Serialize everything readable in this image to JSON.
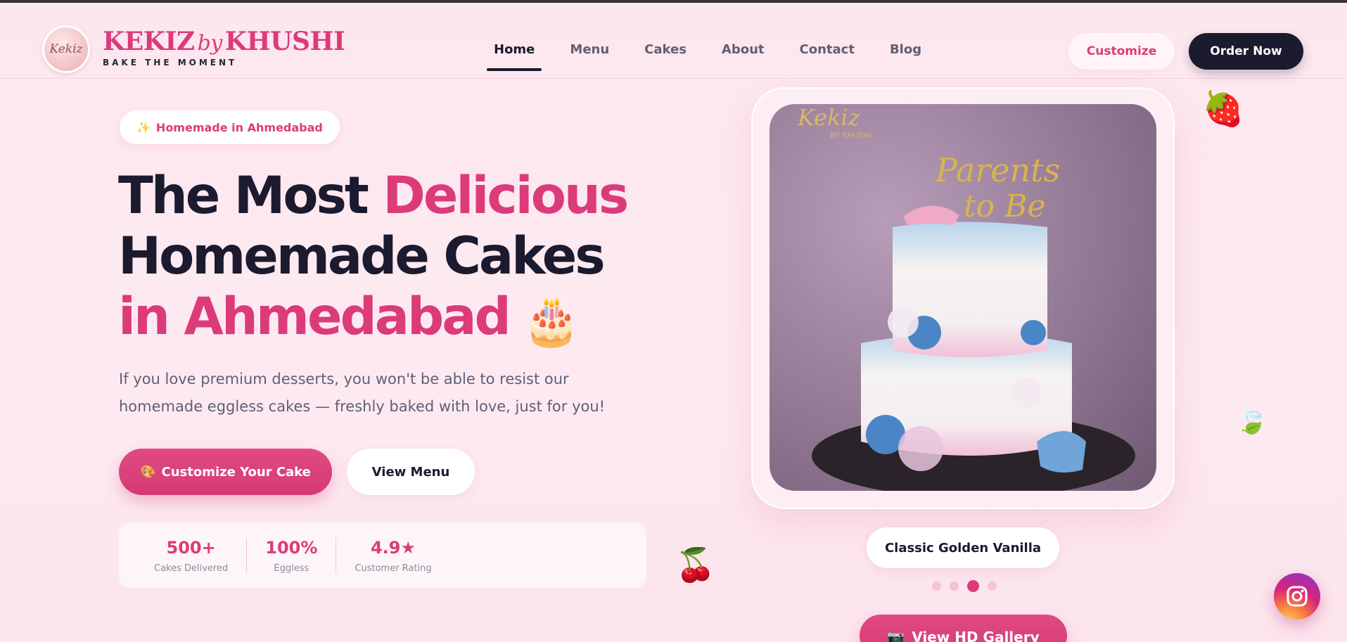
{
  "brand": {
    "logo_text": "Kekiz",
    "name_part1": "KEKIZ",
    "name_by": "by",
    "name_part2": "KHUSHI",
    "tagline": "BAKE THE MOMENT"
  },
  "nav": {
    "items": [
      {
        "label": "Home",
        "active": true
      },
      {
        "label": "Menu"
      },
      {
        "label": "Cakes"
      },
      {
        "label": "About"
      },
      {
        "label": "Contact"
      },
      {
        "label": "Blog"
      }
    ]
  },
  "header_actions": {
    "customize_label": "Customize",
    "order_label": "Order Now"
  },
  "hero": {
    "pill_icon": "✨",
    "pill_text": "Homemade in Ahmedabad",
    "headline_1": "The Most ",
    "headline_1_accent": "Delicious",
    "headline_2": "Homemade Cakes",
    "headline_3_accent": "in Ahmedabad",
    "headline_emoji": "🎂",
    "description": "If you love premium desserts, you won't be able to resist our homemade eggless cakes — freshly baked with love, just for you!",
    "primary_icon": "🎨",
    "primary_label": "Customize Your Cake",
    "secondary_label": "View Menu"
  },
  "stats": [
    {
      "value": "500+",
      "label": "Cakes Delivered"
    },
    {
      "value": "100%",
      "label": "Eggless"
    },
    {
      "value": "4.9★",
      "label": "Customer Rating"
    }
  ],
  "showcase": {
    "watermark": "Kekiz",
    "watermark_sub": "BY KHUSHI",
    "topper_line1": "Parents",
    "topper_line2": "to Be",
    "caption": "Classic Golden Vanilla",
    "slide_count": 4,
    "active_slide": 3,
    "gallery_icon": "📷",
    "gallery_label": "View HD Gallery"
  },
  "decorations": {
    "strawberry": "🍓",
    "leaf": "🍃",
    "cherry": "🍒"
  },
  "colors": {
    "accent": "#dc3b79",
    "dark": "#1b1a2e",
    "background": "#fde7ef"
  }
}
